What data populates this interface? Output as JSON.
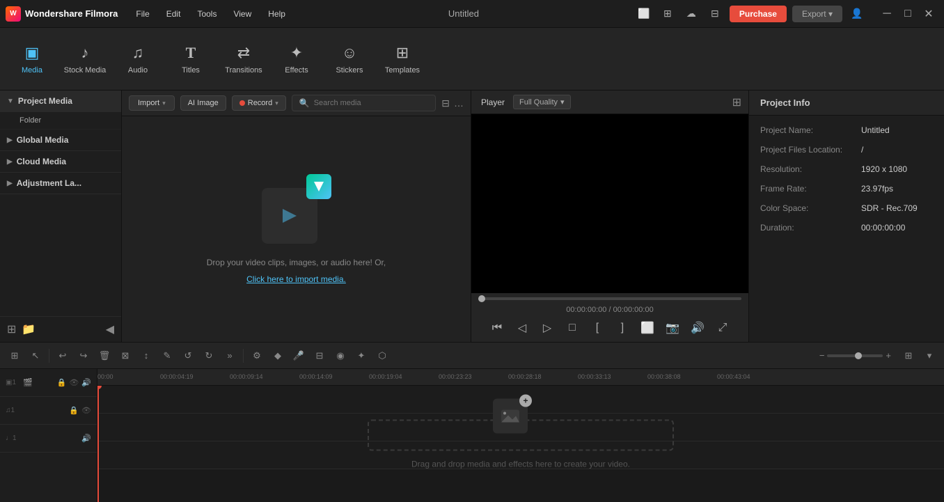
{
  "app": {
    "name": "Wondershare Filmora",
    "title": "Untitled",
    "logo_text": "W"
  },
  "titlebar": {
    "menus": [
      "File",
      "Edit",
      "Tools",
      "View",
      "Help"
    ],
    "purchase_label": "Purchase",
    "export_label": "Export ▾",
    "win_minimize": "─",
    "win_maximize": "□",
    "win_close": "✕"
  },
  "toolbar": {
    "items": [
      {
        "id": "media",
        "icon": "▣",
        "label": "Media",
        "active": true
      },
      {
        "id": "stock-media",
        "icon": "♪",
        "label": "Stock Media"
      },
      {
        "id": "audio",
        "icon": "♫",
        "label": "Audio"
      },
      {
        "id": "titles",
        "icon": "T",
        "label": "Titles"
      },
      {
        "id": "transitions",
        "icon": "⇄",
        "label": "Transitions"
      },
      {
        "id": "effects",
        "icon": "✦",
        "label": "Effects"
      },
      {
        "id": "stickers",
        "icon": "☺",
        "label": "Stickers"
      },
      {
        "id": "templates",
        "icon": "⊞",
        "label": "Templates"
      }
    ]
  },
  "left_panel": {
    "sections": [
      {
        "id": "project-media",
        "label": "Project Media",
        "active": true
      },
      {
        "id": "folder",
        "label": "Folder",
        "indent": true
      },
      {
        "id": "global-media",
        "label": "Global Media"
      },
      {
        "id": "cloud-media",
        "label": "Cloud Media"
      },
      {
        "id": "adjustment-layers",
        "label": "Adjustment La..."
      }
    ]
  },
  "media_toolbar": {
    "import_label": "Import",
    "ai_image_label": "AI Image",
    "record_label": "Record",
    "search_placeholder": "Search media"
  },
  "media_content": {
    "drop_text": "Drop your video clips, images, or audio here! Or,",
    "import_link": "Click here to import media."
  },
  "player": {
    "tab_label": "Player",
    "quality_label": "Full Quality",
    "time_current": "00:00:00:00",
    "time_total": "00:00:00:00"
  },
  "player_controls": {
    "buttons": [
      "⏮",
      "◁",
      "▷",
      "□",
      "[",
      "]",
      "⬜",
      "📷",
      "🔊",
      "⤢"
    ]
  },
  "project_info": {
    "tab_label": "Project Info",
    "fields": [
      {
        "label": "Project Name:",
        "value": "Untitled"
      },
      {
        "label": "Project Files Location:",
        "value": "/"
      },
      {
        "label": "Resolution:",
        "value": "1920 x 1080"
      },
      {
        "label": "Frame Rate:",
        "value": "23.97fps"
      },
      {
        "label": "Color Space:",
        "value": "SDR - Rec.709"
      },
      {
        "label": "Duration:",
        "value": "00:00:00:00"
      }
    ]
  },
  "timeline": {
    "ruler_marks": [
      {
        "time": "00:00",
        "pos": 0
      },
      {
        "time": "00:00:04:19",
        "pos": 90
      },
      {
        "time": "00:00:09:14",
        "pos": 190
      },
      {
        "time": "00:00:14:09",
        "pos": 290
      },
      {
        "time": "00:00:19:04",
        "pos": 390
      },
      {
        "time": "00:00:23:23",
        "pos": 490
      },
      {
        "time": "00:00:28:18",
        "pos": 590
      },
      {
        "time": "00:00:33:13",
        "pos": 690
      },
      {
        "time": "00:00:38:08",
        "pos": 790
      },
      {
        "time": "00:00:43:04",
        "pos": 890
      }
    ],
    "tracks": [
      {
        "type": "video",
        "num": "1",
        "icons": [
          "⊞",
          "□",
          "👁"
        ]
      },
      {
        "type": "audio",
        "num": "1",
        "icons": [
          "♫",
          "□",
          "👁"
        ]
      },
      {
        "type": "audio",
        "num": "1",
        "icons": [
          "♩"
        ]
      }
    ],
    "drop_text": "Drag and drop media and effects here to create your video.",
    "toolbar_buttons": [
      "⊞",
      "↩",
      "↪",
      "🗑",
      "⊠",
      "↕",
      "✎",
      "↺",
      "↻",
      "⊟",
      "»"
    ],
    "zoom_minus": "−",
    "zoom_plus": "+"
  }
}
